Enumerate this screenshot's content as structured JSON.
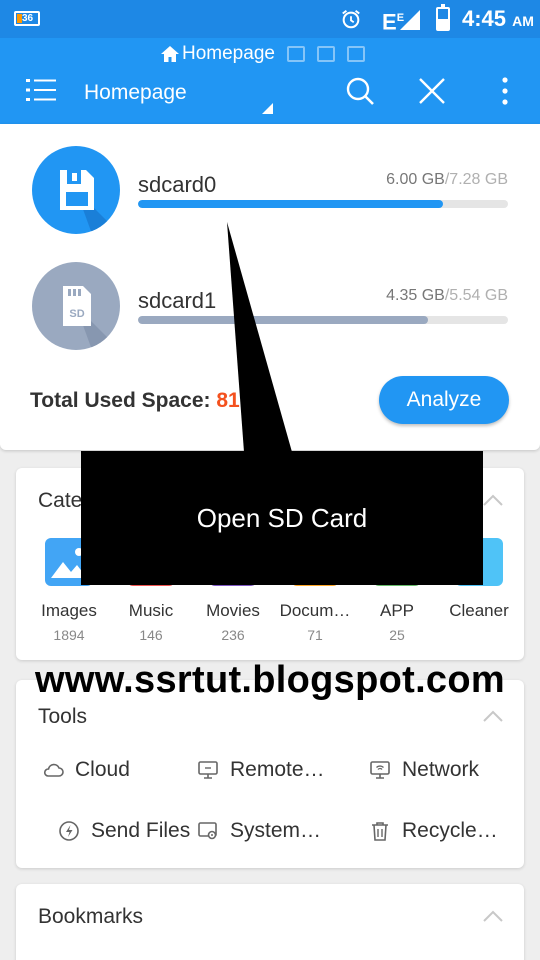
{
  "status_bar": {
    "battery_small_label": "36",
    "signal_label": "E",
    "signal_sup": "E",
    "time": "4:45",
    "time_suffix": "AM"
  },
  "breadcrumb": {
    "home_label": "Homepage"
  },
  "app_bar": {
    "title": "Homepage"
  },
  "storage": {
    "devices": [
      {
        "name": "sdcard0",
        "used": "6.00 GB",
        "total": "/7.28 GB",
        "used_fraction": 0.824,
        "color": "#2196f3",
        "icon": "floppy-disk-icon"
      },
      {
        "name": "sdcard1",
        "used": "4.35 GB",
        "total": "/5.54 GB",
        "used_fraction": 0.785,
        "color": "#9aa9c0",
        "icon": "sd-card-icon"
      }
    ],
    "total_label": "Total Used Space:",
    "total_value": "81",
    "analyze_label": "Analyze"
  },
  "categories": {
    "title": "Cate",
    "items": [
      {
        "label": "Images",
        "count": "1894",
        "color": "#42a5f5",
        "icon": "image-icon"
      },
      {
        "label": "Music",
        "count": "146",
        "color": "#ef5350",
        "icon": "music-icon"
      },
      {
        "label": "Movies",
        "count": "236",
        "color": "#7e57c2",
        "icon": "movie-icon"
      },
      {
        "label": "Docum…",
        "count": "71",
        "color": "#ffa726",
        "icon": "document-icon"
      },
      {
        "label": "APP",
        "count": "25",
        "color": "#66bb6a",
        "icon": "android-icon"
      },
      {
        "label": "Cleaner",
        "count": "",
        "color": "#4fc3f7",
        "icon": "broom-icon"
      }
    ]
  },
  "tools": {
    "title": "Tools",
    "items": [
      {
        "label": "Cloud",
        "icon": "cloud-icon"
      },
      {
        "label": "Remote…",
        "icon": "monitor-icon"
      },
      {
        "label": "Network",
        "icon": "network-icon"
      },
      {
        "label": "Send Files",
        "icon": "send-icon"
      },
      {
        "label": "System…",
        "icon": "system-icon"
      },
      {
        "label": "Recycle…",
        "icon": "trash-icon"
      }
    ]
  },
  "bookmarks": {
    "title": "Bookmarks"
  },
  "tooltip": {
    "text": "Open SD Card"
  },
  "watermark": {
    "text": "www.ssrtut.blogspot.com"
  },
  "colors": {
    "status_bar": "#1e88e5",
    "app_bar": "#2196f3",
    "accent_orange": "#f4511e"
  }
}
